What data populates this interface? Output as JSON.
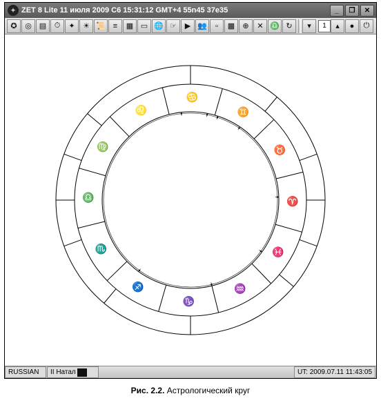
{
  "title_bar": {
    "text": "ZET 8 Lite   11 июля 2009  С6  15:31:12 GMT+4 55n45   37e35",
    "app_icon": "zet-icon"
  },
  "window_buttons": {
    "minimize": "_",
    "maximize": "❐",
    "close": "✕"
  },
  "toolbar": {
    "items": [
      {
        "name": "globe-icon",
        "glyph": "✪"
      },
      {
        "name": "target-icon",
        "glyph": "◎"
      },
      {
        "name": "doc-icon",
        "glyph": "▤"
      },
      {
        "name": "clock-icon",
        "glyph": "⏱"
      },
      {
        "name": "search-icon",
        "glyph": "✦"
      },
      {
        "name": "sun-icon",
        "glyph": "☀"
      },
      {
        "name": "scroll-icon",
        "glyph": "📜"
      },
      {
        "name": "list-icon",
        "glyph": "≡"
      },
      {
        "name": "grid-icon",
        "glyph": "▦"
      },
      {
        "name": "form-icon",
        "glyph": "▭"
      },
      {
        "name": "web-icon",
        "glyph": "🌐"
      },
      {
        "name": "hand-icon",
        "glyph": "☞"
      },
      {
        "name": "step-icon",
        "glyph": "▶"
      },
      {
        "name": "people-icon",
        "glyph": "👥"
      },
      {
        "name": "page-icon",
        "glyph": "▫"
      },
      {
        "name": "map-icon",
        "glyph": "▩"
      },
      {
        "name": "atlas-icon",
        "glyph": "⊕"
      },
      {
        "name": "tools-icon",
        "glyph": "✕"
      },
      {
        "name": "libra-icon",
        "glyph": "♎"
      },
      {
        "name": "refresh-icon",
        "glyph": "↻"
      }
    ],
    "end_items": [
      {
        "name": "marker-icon",
        "glyph": "●"
      },
      {
        "name": "power-icon",
        "glyph": "⏻"
      }
    ],
    "chart_number": "1"
  },
  "status_bar": {
    "language": "RUSSIAN",
    "natal_label": "II Натал",
    "ut_label": "UT: 2009.07.11 11:43:05"
  },
  "chart_data": {
    "type": "zodiac-wheel",
    "title": "",
    "outer_radius": 195,
    "mid_radius": 168,
    "inner_radius": 128,
    "zodiac_signs": [
      {
        "sign": "Aries",
        "glyph": "♈",
        "start_deg": 0
      },
      {
        "sign": "Taurus",
        "glyph": "♉",
        "start_deg": 30
      },
      {
        "sign": "Gemini",
        "glyph": "♊",
        "start_deg": 60
      },
      {
        "sign": "Cancer",
        "glyph": "♋",
        "start_deg": 90
      },
      {
        "sign": "Leo",
        "glyph": "♌",
        "start_deg": 120
      },
      {
        "sign": "Virgo",
        "glyph": "♍",
        "start_deg": 150
      },
      {
        "sign": "Libra",
        "glyph": "♎",
        "start_deg": 180
      },
      {
        "sign": "Scorpio",
        "glyph": "♏",
        "start_deg": 210
      },
      {
        "sign": "Sagittarius",
        "glyph": "♐",
        "start_deg": 240
      },
      {
        "sign": "Capricorn",
        "glyph": "♑",
        "start_deg": 270
      },
      {
        "sign": "Aquarius",
        "glyph": "♒",
        "start_deg": 300
      },
      {
        "sign": "Pisces",
        "glyph": "♓",
        "start_deg": 330
      }
    ],
    "ascendant_deg": 196,
    "house_cusps_relative_deg": [
      0,
      20,
      50,
      90,
      140,
      160,
      180,
      200,
      230,
      270,
      320,
      340
    ]
  },
  "caption": {
    "number": "Рис. 2.2.",
    "text": "Астрологический круг"
  }
}
